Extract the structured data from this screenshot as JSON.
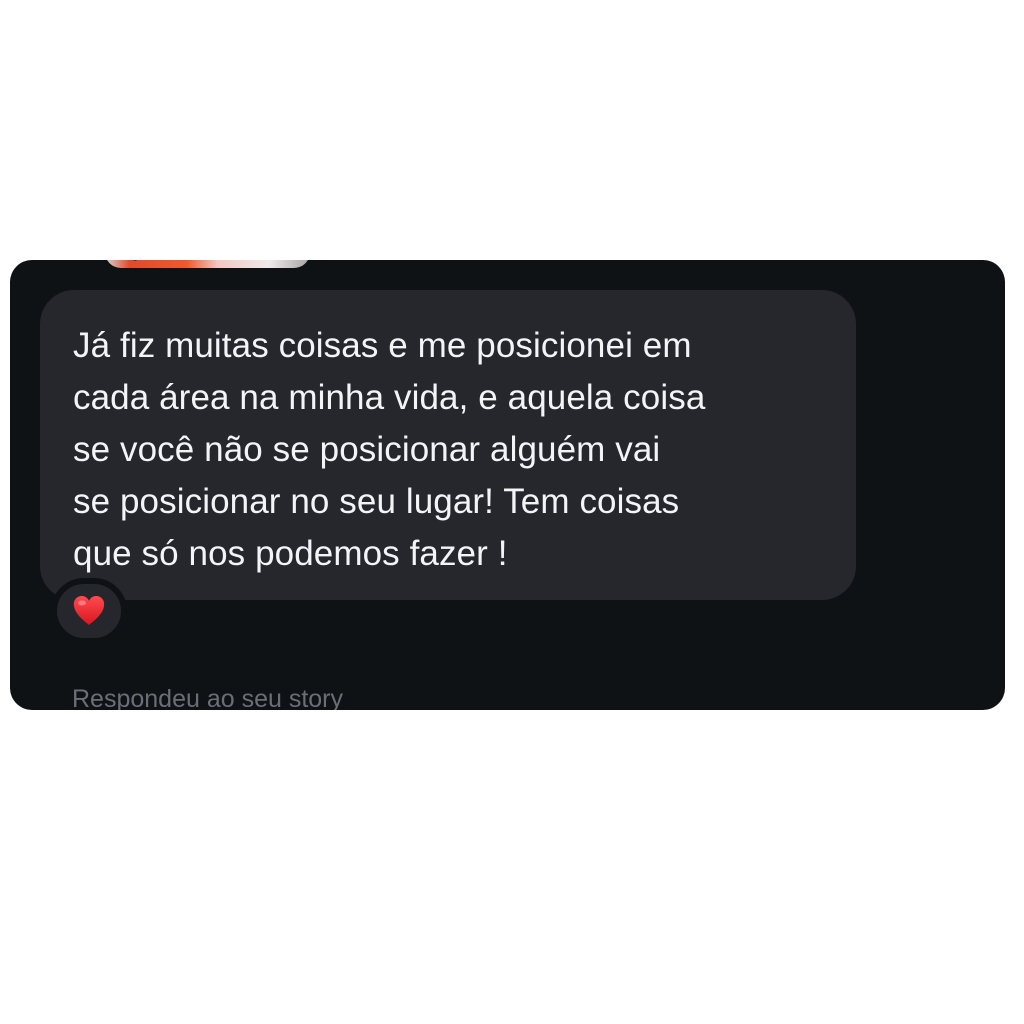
{
  "conversation": {
    "message": {
      "text": "Já fiz muitas coisas e me posicionei em\ncada área na minha vida, e aquela coisa\nse você não se posicionar alguém vai\nse posicionar no seu lugar! Tem coisas\nque só nos podemos fazer !",
      "reaction": {
        "icon": "heart-icon",
        "color": "#e3262b"
      }
    },
    "story_reply_label": "Respondeu ao seu story"
  },
  "colors": {
    "background": "#ffffff",
    "panel": "#0f1215",
    "bubble": "#25272c",
    "message_text": "#f3f4f6",
    "muted_text": "#6b6e74"
  }
}
